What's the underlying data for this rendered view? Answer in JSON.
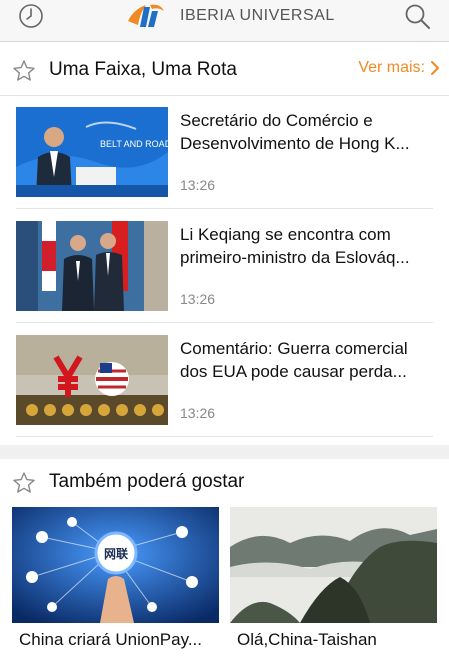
{
  "header": {
    "brand": "IBERIA UNIVERSAL"
  },
  "section_belt": {
    "title": "Uma Faixa, Uma Rota",
    "more_label": "Ver  mais:",
    "items": [
      {
        "headline": "Secretário do Comércio e Desenvolvimento de Hong K...",
        "time": "13:26",
        "thumb_text": "BELT AND ROAD"
      },
      {
        "headline": "Li Keqiang se encontra com primeiro-ministro da Eslováq...",
        "time": "13:26"
      },
      {
        "headline": "Comentário: Guerra comercial dos EUA pode causar perda...",
        "time": "13:26"
      }
    ]
  },
  "section_like": {
    "title": "Também poderá gostar",
    "cards": [
      {
        "title": "China criará UnionPay...",
        "thumb_text": "网联"
      },
      {
        "title": "Olá,China-Taishan"
      }
    ]
  },
  "colors": {
    "accent": "#f08a24",
    "brand_blue": "#1f6fc7"
  }
}
